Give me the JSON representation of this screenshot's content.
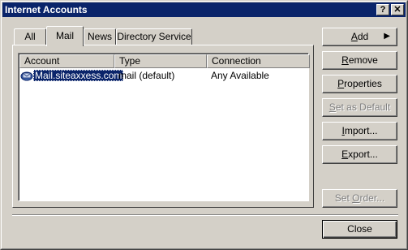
{
  "window": {
    "title": "Internet Accounts",
    "help_glyph": "?",
    "close_glyph": "✕"
  },
  "tabs": [
    {
      "label": "All",
      "active": false
    },
    {
      "label": "Mail",
      "active": true
    },
    {
      "label": "News",
      "active": false
    },
    {
      "label": "Directory Service",
      "active": false
    }
  ],
  "list": {
    "columns": [
      "Account",
      "Type",
      "Connection"
    ],
    "rows": [
      {
        "account": "Mail.siteaxxess.com",
        "type": "mail (default)",
        "connection": "Any Available",
        "selected": true
      }
    ]
  },
  "buttons": {
    "add": {
      "pre": "",
      "ul": "A",
      "post": "dd",
      "arrow": "▶",
      "enabled": true
    },
    "remove": {
      "pre": "",
      "ul": "R",
      "post": "emove",
      "enabled": true
    },
    "properties": {
      "pre": "",
      "ul": "P",
      "post": "roperties",
      "enabled": true
    },
    "set_default": {
      "pre": "",
      "ul": "S",
      "post": "et as Default",
      "enabled": false
    },
    "import": {
      "pre": "",
      "ul": "I",
      "post": "mport...",
      "enabled": true
    },
    "export": {
      "pre": "",
      "ul": "E",
      "post": "xport...",
      "enabled": true
    },
    "set_order": {
      "pre": "Set ",
      "ul": "O",
      "post": "rder...",
      "enabled": false
    },
    "close": {
      "pre": "Close",
      "ul": "",
      "post": "",
      "enabled": true
    }
  },
  "colors": {
    "titlebar": "#0a246a",
    "face": "#d4d0c8",
    "selection": "#0a246a"
  }
}
